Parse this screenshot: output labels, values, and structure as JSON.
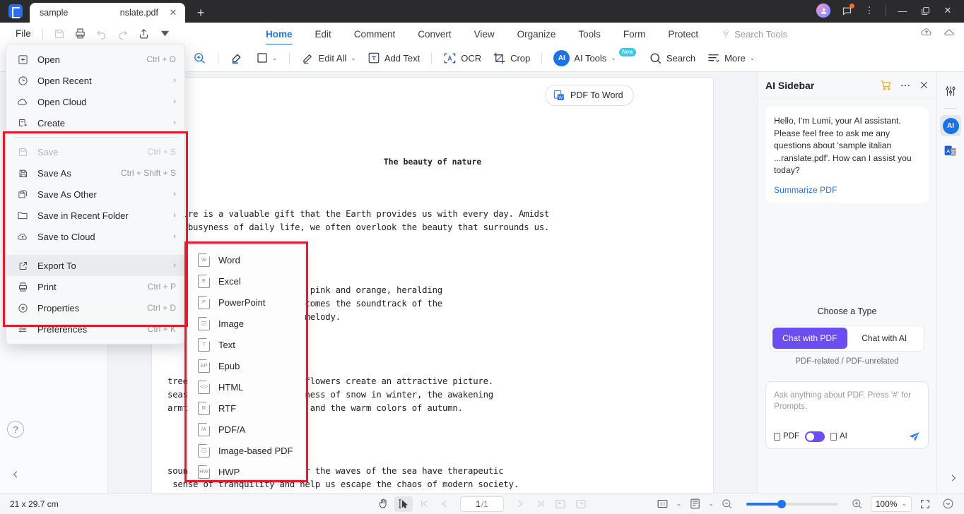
{
  "titlebar": {
    "tab_title_left": "sample",
    "tab_title_right": "nslate.pdf",
    "close_glyph": "✕",
    "newtab_glyph": "+",
    "minimize_glyph": "—",
    "restore_glyph": "❐",
    "window_close_glyph": "✕",
    "more_glyph": "⋮"
  },
  "menubar": {
    "file_label": "File",
    "quick_icons": [
      "save-icon",
      "print-icon",
      "undo-icon",
      "redo-icon",
      "share-icon",
      "customize-icon"
    ]
  },
  "ribbon": {
    "tabs": [
      {
        "label": "Home",
        "active": true
      },
      {
        "label": "Edit",
        "active": false
      },
      {
        "label": "Comment",
        "active": false
      },
      {
        "label": "Convert",
        "active": false
      },
      {
        "label": "View",
        "active": false
      },
      {
        "label": "Organize",
        "active": false
      },
      {
        "label": "Tools",
        "active": false
      },
      {
        "label": "Form",
        "active": false
      },
      {
        "label": "Protect",
        "active": false
      }
    ],
    "search_tools": "Search Tools"
  },
  "toolbar": {
    "shape_caret": "⌄",
    "edit_all": "Edit All",
    "add_text": "Add Text",
    "ocr": "OCR",
    "crop": "Crop",
    "ai_tools": "AI Tools",
    "ai_badge": "New",
    "search": "Search",
    "more": "More"
  },
  "file_menu": {
    "items": [
      {
        "label": "Open",
        "accel": "Ctrl + O",
        "icon": "plus-box-icon",
        "arrow": false,
        "disabled": false,
        "selected": false
      },
      {
        "label": "Open Recent",
        "accel": "",
        "icon": "clock-icon",
        "arrow": true,
        "disabled": false,
        "selected": false
      },
      {
        "label": "Open Cloud",
        "accel": "",
        "icon": "cloud-icon",
        "arrow": true,
        "disabled": false,
        "selected": false
      },
      {
        "label": "Create",
        "accel": "",
        "icon": "create-doc-icon",
        "arrow": true,
        "disabled": false,
        "selected": false
      },
      {
        "label": "Save",
        "accel": "Ctrl + S",
        "icon": "save-icon",
        "arrow": false,
        "disabled": true,
        "selected": false
      },
      {
        "label": "Save As",
        "accel": "Ctrl + Shift + S",
        "icon": "save-as-icon",
        "arrow": false,
        "disabled": false,
        "selected": false
      },
      {
        "label": "Save As Other",
        "accel": "",
        "icon": "save-as-other-icon",
        "arrow": true,
        "disabled": false,
        "selected": false
      },
      {
        "label": "Save in Recent Folder",
        "accel": "",
        "icon": "folder-icon",
        "arrow": true,
        "disabled": false,
        "selected": false
      },
      {
        "label": "Save to Cloud",
        "accel": "",
        "icon": "cloud-upload-icon",
        "arrow": true,
        "disabled": false,
        "selected": false
      },
      {
        "label": "Export To",
        "accel": "",
        "icon": "export-icon",
        "arrow": true,
        "disabled": false,
        "selected": true
      },
      {
        "label": "Print",
        "accel": "Ctrl + P",
        "icon": "print-icon",
        "arrow": false,
        "disabled": false,
        "selected": false
      },
      {
        "label": "Properties",
        "accel": "Ctrl + D",
        "icon": "properties-icon",
        "arrow": false,
        "disabled": false,
        "selected": false
      },
      {
        "label": "Preferences",
        "accel": "Ctrl + K",
        "icon": "preferences-icon",
        "arrow": false,
        "disabled": false,
        "selected": false
      }
    ]
  },
  "export_submenu": {
    "items": [
      {
        "label": "Word",
        "badge": "W"
      },
      {
        "label": "Excel",
        "badge": "E"
      },
      {
        "label": "PowerPoint",
        "badge": "P"
      },
      {
        "label": "Image",
        "badge": "◲"
      },
      {
        "label": "Text",
        "badge": "T"
      },
      {
        "label": "Epub",
        "badge": "EP"
      },
      {
        "label": "HTML",
        "badge": "</>"
      },
      {
        "label": "RTF",
        "badge": "R"
      },
      {
        "label": "PDF/A",
        "badge": "/A"
      },
      {
        "label": "Image-based PDF",
        "badge": "◲"
      },
      {
        "label": "HWP",
        "badge": "HW"
      }
    ]
  },
  "document": {
    "pdf_to_word": "PDF To Word",
    "title": "The beauty of nature",
    "p1": "Nature is a valuable gift that the Earth provides us with every day. Amidst\nthe busyness of daily life, we often overlook the beauty that surrounds us.",
    "p2": "y is adorned with shades of pink and orange, heralding\ny. The chirping of birds becomes the soundtrack of the\nsenses with its refreshing melody.",
    "p3": "trees and the fragrance of flowers create an attractive picture.\nseasonal changes: the whiteness of snow in winter, the awakening\narmth of the sun in summer, and the warm colors of autumn.",
    "p4": "sound of a flowing stream or the waves of the sea have therapeutic\n sense of tranquility and help us escape the chaos of modern society."
  },
  "ai_sidebar": {
    "title": "AI Sidebar",
    "message": "Hello, I'm Lumi, your AI assistant. Please feel free to ask me any questions about 'sample italian ...ranslate.pdf'. How can I assist you today?",
    "summarize_link": "Summarize PDF",
    "choose_a_type": "Choose a Type",
    "option_pdf": "Chat with PDF",
    "option_ai": "Chat with AI",
    "seg_note": "PDF-related / PDF-unrelated",
    "composer_placeholder": "Ask anything about PDF. Press '#' for Prompts.",
    "toggle_left": "PDF",
    "toggle_right": "AI",
    "accent": "#6c4ef0"
  },
  "statusbar": {
    "page_size": "21 x 29.7 cm",
    "page_current": "1",
    "page_total": "/1",
    "zoom": "100%",
    "zoom_caret": "⌄",
    "fit_caret": "⌄",
    "layout_caret": "⌄",
    "fit_label": "1:1"
  }
}
